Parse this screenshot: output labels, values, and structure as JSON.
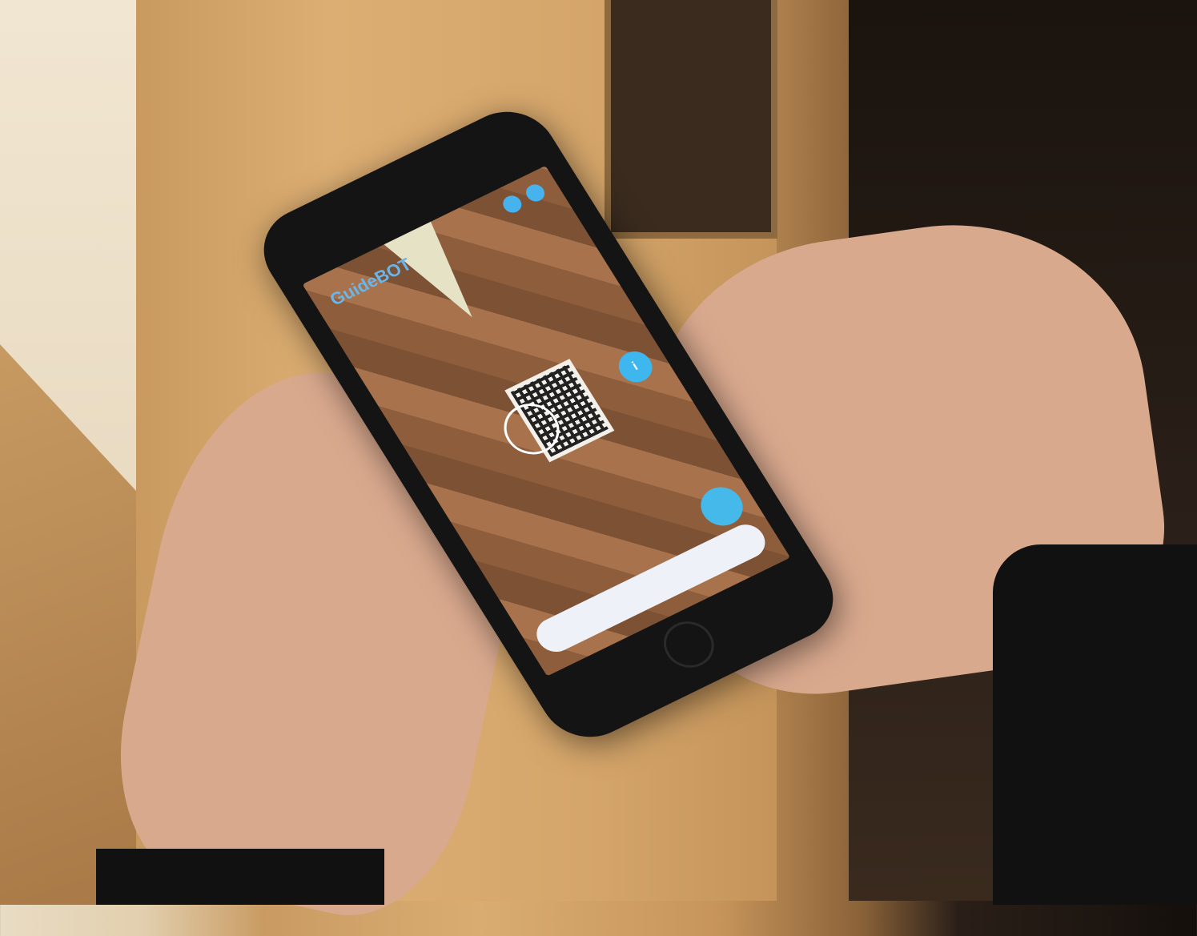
{
  "app": {
    "logo_text": "GuideBOT",
    "accent_color": "#46b3ee",
    "info_icon": "info-icon",
    "send_icon": "microphone-icon"
  }
}
